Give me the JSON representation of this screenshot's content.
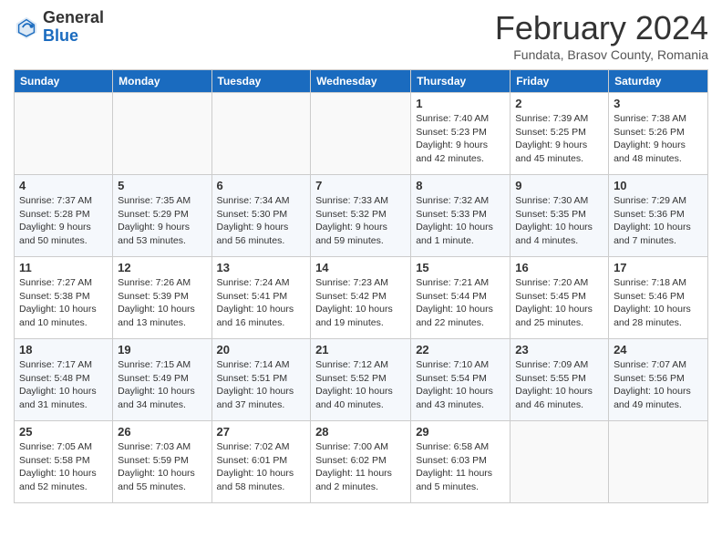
{
  "header": {
    "logo_general": "General",
    "logo_blue": "Blue",
    "month_title": "February 2024",
    "subtitle": "Fundata, Brasov County, Romania"
  },
  "days_of_week": [
    "Sunday",
    "Monday",
    "Tuesday",
    "Wednesday",
    "Thursday",
    "Friday",
    "Saturday"
  ],
  "weeks": [
    [
      {
        "day": "",
        "info": ""
      },
      {
        "day": "",
        "info": ""
      },
      {
        "day": "",
        "info": ""
      },
      {
        "day": "",
        "info": ""
      },
      {
        "day": "1",
        "info": "Sunrise: 7:40 AM\nSunset: 5:23 PM\nDaylight: 9 hours\nand 42 minutes."
      },
      {
        "day": "2",
        "info": "Sunrise: 7:39 AM\nSunset: 5:25 PM\nDaylight: 9 hours\nand 45 minutes."
      },
      {
        "day": "3",
        "info": "Sunrise: 7:38 AM\nSunset: 5:26 PM\nDaylight: 9 hours\nand 48 minutes."
      }
    ],
    [
      {
        "day": "4",
        "info": "Sunrise: 7:37 AM\nSunset: 5:28 PM\nDaylight: 9 hours\nand 50 minutes."
      },
      {
        "day": "5",
        "info": "Sunrise: 7:35 AM\nSunset: 5:29 PM\nDaylight: 9 hours\nand 53 minutes."
      },
      {
        "day": "6",
        "info": "Sunrise: 7:34 AM\nSunset: 5:30 PM\nDaylight: 9 hours\nand 56 minutes."
      },
      {
        "day": "7",
        "info": "Sunrise: 7:33 AM\nSunset: 5:32 PM\nDaylight: 9 hours\nand 59 minutes."
      },
      {
        "day": "8",
        "info": "Sunrise: 7:32 AM\nSunset: 5:33 PM\nDaylight: 10 hours\nand 1 minute."
      },
      {
        "day": "9",
        "info": "Sunrise: 7:30 AM\nSunset: 5:35 PM\nDaylight: 10 hours\nand 4 minutes."
      },
      {
        "day": "10",
        "info": "Sunrise: 7:29 AM\nSunset: 5:36 PM\nDaylight: 10 hours\nand 7 minutes."
      }
    ],
    [
      {
        "day": "11",
        "info": "Sunrise: 7:27 AM\nSunset: 5:38 PM\nDaylight: 10 hours\nand 10 minutes."
      },
      {
        "day": "12",
        "info": "Sunrise: 7:26 AM\nSunset: 5:39 PM\nDaylight: 10 hours\nand 13 minutes."
      },
      {
        "day": "13",
        "info": "Sunrise: 7:24 AM\nSunset: 5:41 PM\nDaylight: 10 hours\nand 16 minutes."
      },
      {
        "day": "14",
        "info": "Sunrise: 7:23 AM\nSunset: 5:42 PM\nDaylight: 10 hours\nand 19 minutes."
      },
      {
        "day": "15",
        "info": "Sunrise: 7:21 AM\nSunset: 5:44 PM\nDaylight: 10 hours\nand 22 minutes."
      },
      {
        "day": "16",
        "info": "Sunrise: 7:20 AM\nSunset: 5:45 PM\nDaylight: 10 hours\nand 25 minutes."
      },
      {
        "day": "17",
        "info": "Sunrise: 7:18 AM\nSunset: 5:46 PM\nDaylight: 10 hours\nand 28 minutes."
      }
    ],
    [
      {
        "day": "18",
        "info": "Sunrise: 7:17 AM\nSunset: 5:48 PM\nDaylight: 10 hours\nand 31 minutes."
      },
      {
        "day": "19",
        "info": "Sunrise: 7:15 AM\nSunset: 5:49 PM\nDaylight: 10 hours\nand 34 minutes."
      },
      {
        "day": "20",
        "info": "Sunrise: 7:14 AM\nSunset: 5:51 PM\nDaylight: 10 hours\nand 37 minutes."
      },
      {
        "day": "21",
        "info": "Sunrise: 7:12 AM\nSunset: 5:52 PM\nDaylight: 10 hours\nand 40 minutes."
      },
      {
        "day": "22",
        "info": "Sunrise: 7:10 AM\nSunset: 5:54 PM\nDaylight: 10 hours\nand 43 minutes."
      },
      {
        "day": "23",
        "info": "Sunrise: 7:09 AM\nSunset: 5:55 PM\nDaylight: 10 hours\nand 46 minutes."
      },
      {
        "day": "24",
        "info": "Sunrise: 7:07 AM\nSunset: 5:56 PM\nDaylight: 10 hours\nand 49 minutes."
      }
    ],
    [
      {
        "day": "25",
        "info": "Sunrise: 7:05 AM\nSunset: 5:58 PM\nDaylight: 10 hours\nand 52 minutes."
      },
      {
        "day": "26",
        "info": "Sunrise: 7:03 AM\nSunset: 5:59 PM\nDaylight: 10 hours\nand 55 minutes."
      },
      {
        "day": "27",
        "info": "Sunrise: 7:02 AM\nSunset: 6:01 PM\nDaylight: 10 hours\nand 58 minutes."
      },
      {
        "day": "28",
        "info": "Sunrise: 7:00 AM\nSunset: 6:02 PM\nDaylight: 11 hours\nand 2 minutes."
      },
      {
        "day": "29",
        "info": "Sunrise: 6:58 AM\nSunset: 6:03 PM\nDaylight: 11 hours\nand 5 minutes."
      },
      {
        "day": "",
        "info": ""
      },
      {
        "day": "",
        "info": ""
      }
    ]
  ]
}
